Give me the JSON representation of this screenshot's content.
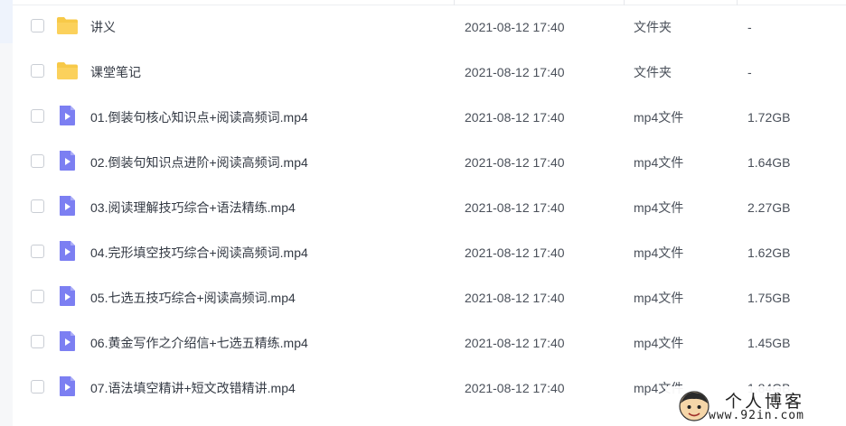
{
  "files": [
    {
      "name": "讲义",
      "modified": "2021-08-12 17:40",
      "type": "文件夹",
      "size": "-",
      "icon": "folder-icon"
    },
    {
      "name": "课堂笔记",
      "modified": "2021-08-12 17:40",
      "type": "文件夹",
      "size": "-",
      "icon": "folder-icon"
    },
    {
      "name": "01.倒装句核心知识点+阅读高频词.mp4",
      "modified": "2021-08-12 17:40",
      "type": "mp4文件",
      "size": "1.72GB",
      "icon": "video-file-icon"
    },
    {
      "name": "02.倒装句知识点进阶+阅读高频词.mp4",
      "modified": "2021-08-12 17:40",
      "type": "mp4文件",
      "size": "1.64GB",
      "icon": "video-file-icon"
    },
    {
      "name": "03.阅读理解技巧综合+语法精练.mp4",
      "modified": "2021-08-12 17:40",
      "type": "mp4文件",
      "size": "2.27GB",
      "icon": "video-file-icon"
    },
    {
      "name": "04.完形填空技巧综合+阅读高频词.mp4",
      "modified": "2021-08-12 17:40",
      "type": "mp4文件",
      "size": "1.62GB",
      "icon": "video-file-icon"
    },
    {
      "name": "05.七选五技巧综合+阅读高频词.mp4",
      "modified": "2021-08-12 17:40",
      "type": "mp4文件",
      "size": "1.75GB",
      "icon": "video-file-icon"
    },
    {
      "name": "06.黄金写作之介绍信+七选五精练.mp4",
      "modified": "2021-08-12 17:40",
      "type": "mp4文件",
      "size": "1.45GB",
      "icon": "video-file-icon"
    },
    {
      "name": "07.语法填空精讲+短文改错精讲.mp4",
      "modified": "2021-08-12 17:40",
      "type": "mp4文件",
      "size": "1.84GB",
      "icon": "video-file-icon"
    }
  ],
  "watermark": {
    "title": "个人博客",
    "url": "www.92in.com"
  },
  "colors": {
    "folder": "#f7c948",
    "video": "#7c7ff2",
    "checkbox_border": "#c9cdd4"
  }
}
